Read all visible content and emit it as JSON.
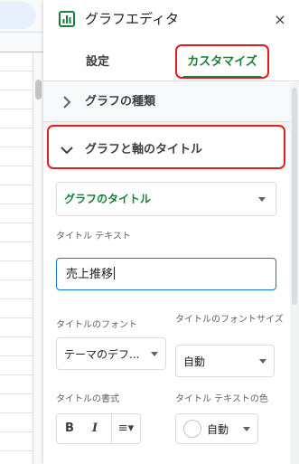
{
  "editor": {
    "title": "グラフエディタ",
    "close_label": "×"
  },
  "tabs": [
    {
      "label": "設定",
      "active": false
    },
    {
      "label": "カスタマイズ",
      "active": true
    }
  ],
  "sections": {
    "chart_type_header": "グラフの種類",
    "titles_header": "グラフと軸のタイトル"
  },
  "titles": {
    "selected_target": "グラフのタイトル",
    "title_text_label": "タイトル テキスト",
    "title_text_value": "売上推移",
    "font_label": "タイトルのフォント",
    "font_value": "テーマのデフ...",
    "font_size_label": "タイトルのフォントサイズ",
    "font_size_value": "自動",
    "format_label": "タイトルの書式",
    "format_buttons": {
      "bold": "B",
      "italic": "I",
      "align": "≡▾"
    },
    "color_label": "タイトル テキストの色",
    "color_value": "自動",
    "color_swatch": "#ffffff"
  },
  "colors": {
    "accent": "#188038",
    "focus": "#1a73e8",
    "highlight": "#e31c1c"
  },
  "icons": {
    "header": "chart-icon",
    "close": "close-icon",
    "collapsed_section": "chevron-right-icon",
    "expanded_section": "chevron-down-icon",
    "dropdown": "caret-down-icon"
  }
}
